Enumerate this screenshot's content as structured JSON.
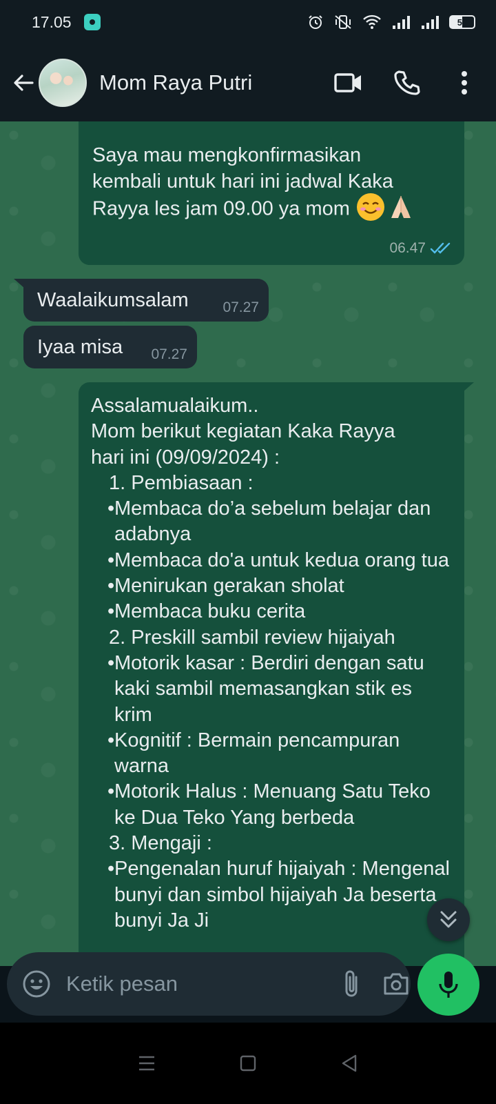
{
  "status_bar": {
    "time": "17.05",
    "battery": "50"
  },
  "header": {
    "contact_name": "Mom Raya Putri"
  },
  "messages": [
    {
      "direction": "out",
      "text": "Saya mau mengkonfirmasikan\nkembali untuk hari ini jadwal Kaka\nRayya les jam 09.00 ya mom",
      "time": "06.47",
      "read": true
    },
    {
      "direction": "in",
      "text": "Waalaikumsalam",
      "time": "07.27"
    },
    {
      "direction": "in",
      "text": "Iyaa misa",
      "time": "07.27"
    }
  ],
  "long_message": {
    "intro": [
      "Assalamualaikum..",
      "Mom berikut kegiatan Kaka Rayya",
      "hari ini (09/09/2024) :"
    ],
    "section1": "1. Pembiasaan :",
    "section1_items": [
      "Membaca do’a sebelum belajar dan adabnya",
      "Membaca do'a untuk kedua orang tua",
      "Menirukan gerakan sholat",
      "Membaca buku cerita"
    ],
    "section2": "2. Preskill sambil review hijaiyah",
    "section2_items": [
      "Motorik kasar :  Berdiri dengan satu kaki sambil memasangkan stik es krim",
      "Kognitif : Bermain pencampuran warna",
      "Motorik Halus :   Menuang Satu Teko ke Dua Teko Yang berbeda"
    ],
    "section3": "3. Mengaji :",
    "section3_items": [
      "Pengenalan huruf hijaiyah : Mengenal bunyi dan simbol hijaiyah Ja beserta bunyi Ja Ji"
    ]
  },
  "input": {
    "placeholder": "Ketik pesan"
  },
  "colors": {
    "accent_green": "#21c063",
    "chat_bg": "#2f6b4d",
    "outgoing_bubble": "#15503c",
    "incoming_bubble": "#1f2c34",
    "read_tick": "#53bdeb"
  }
}
